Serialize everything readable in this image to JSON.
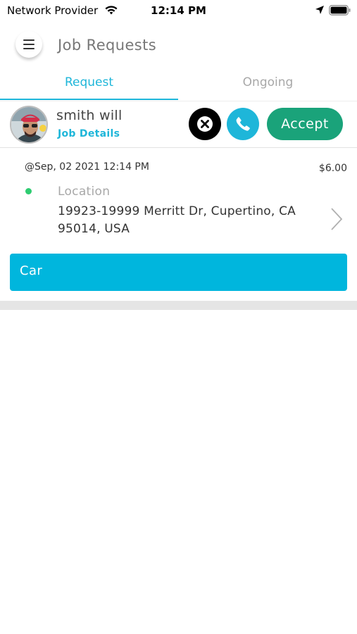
{
  "status_bar": {
    "carrier": "Network Provider",
    "time": "12:14 PM",
    "icons": [
      "wifi-icon",
      "location-arrow-icon",
      "battery-icon"
    ]
  },
  "header": {
    "title": "Job Requests",
    "menu_icon": "hamburger-menu-icon"
  },
  "tabs": [
    {
      "label": "Request",
      "active": true
    },
    {
      "label": "Ongoing",
      "active": false
    }
  ],
  "request": {
    "user_name": "smith will",
    "details_link": "Job Details",
    "accept_label": "Accept",
    "reject_icon": "close-icon",
    "call_icon": "phone-icon",
    "datetime": "@Sep, 02 2021 12:14 PM",
    "price": "$6.00",
    "location_label": "Location",
    "address": "19923-19999 Merritt Dr, Cupertino, CA 95014, USA",
    "vehicle_type": "Car"
  },
  "colors": {
    "accent": "#1eb6d9",
    "accept": "#1aa37a",
    "location_dot": "#2ecc71",
    "vehicle_bar": "#00b6dd"
  }
}
